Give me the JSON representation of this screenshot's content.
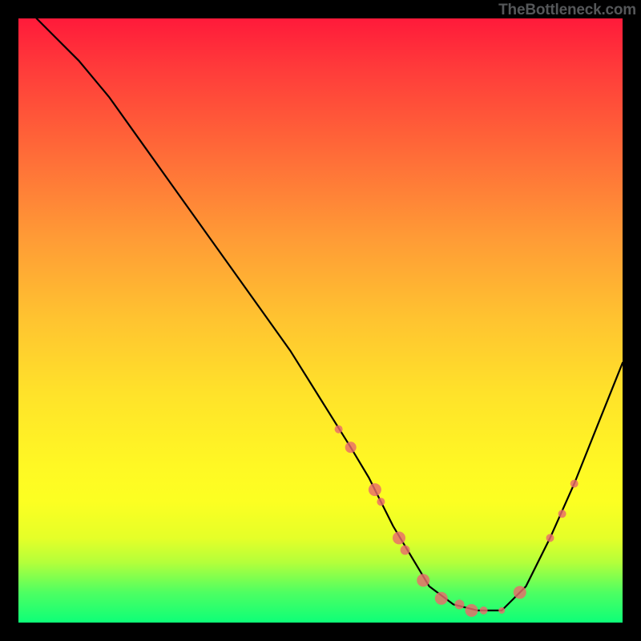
{
  "attribution": "TheBottleneck.com",
  "chart_data": {
    "type": "line",
    "title": "",
    "xlabel": "",
    "ylabel": "",
    "xlim": [
      0,
      100
    ],
    "ylim": [
      0,
      100
    ],
    "curve": {
      "name": "bottleneck-curve",
      "x": [
        3,
        6,
        10,
        15,
        20,
        25,
        30,
        35,
        40,
        45,
        50,
        55,
        58,
        60,
        62,
        65,
        68,
        72,
        76,
        80,
        84,
        88,
        92,
        96,
        100
      ],
      "y": [
        100,
        97,
        93,
        87,
        80,
        73,
        66,
        59,
        52,
        45,
        37,
        29,
        24,
        20,
        16,
        11,
        6,
        3,
        2,
        2,
        6,
        14,
        23,
        33,
        43
      ]
    },
    "markers": [
      {
        "x": 53,
        "y": 32,
        "r": 5
      },
      {
        "x": 55,
        "y": 29,
        "r": 7
      },
      {
        "x": 59,
        "y": 22,
        "r": 8
      },
      {
        "x": 60,
        "y": 20,
        "r": 5
      },
      {
        "x": 63,
        "y": 14,
        "r": 8
      },
      {
        "x": 64,
        "y": 12,
        "r": 6
      },
      {
        "x": 67,
        "y": 7,
        "r": 8
      },
      {
        "x": 70,
        "y": 4,
        "r": 8
      },
      {
        "x": 73,
        "y": 3,
        "r": 6
      },
      {
        "x": 75,
        "y": 2,
        "r": 8
      },
      {
        "x": 77,
        "y": 2,
        "r": 5
      },
      {
        "x": 80,
        "y": 2,
        "r": 4
      },
      {
        "x": 83,
        "y": 5,
        "r": 8
      },
      {
        "x": 88,
        "y": 14,
        "r": 5
      },
      {
        "x": 90,
        "y": 18,
        "r": 5
      },
      {
        "x": 92,
        "y": 23,
        "r": 5
      }
    ],
    "background_gradient": {
      "top": "#ff1a3a",
      "bottom": "#0dff78"
    }
  }
}
